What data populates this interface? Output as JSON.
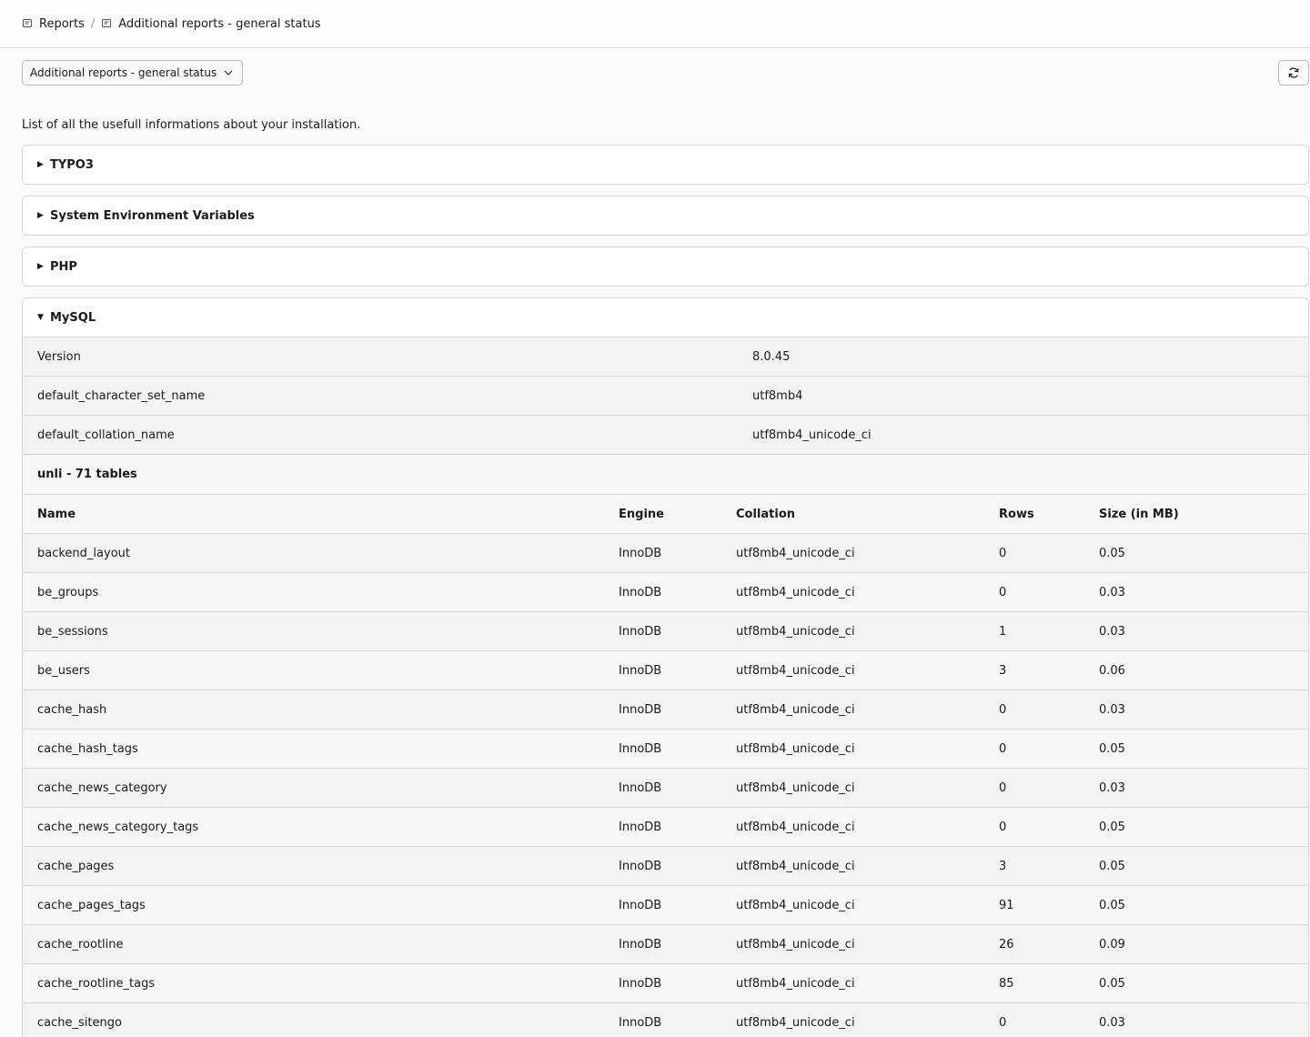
{
  "breadcrumb": {
    "root": "Reports",
    "current": "Additional reports - general status"
  },
  "toolbar": {
    "dropdown_value": "Additional reports - general status"
  },
  "intro": "List of all the usefull informations about your installation.",
  "sections": [
    {
      "title": "TYPO3",
      "expanded": false
    },
    {
      "title": "System Environment Variables",
      "expanded": false
    },
    {
      "title": "PHP",
      "expanded": false
    },
    {
      "title": "MySQL",
      "expanded": true
    }
  ],
  "mysql": {
    "properties": [
      {
        "key": "Version",
        "value": "8.0.45"
      },
      {
        "key": "default_character_set_name",
        "value": "utf8mb4"
      },
      {
        "key": "default_collation_name",
        "value": "utf8mb4_unicode_ci"
      }
    ],
    "database_title": "unli - 71 tables",
    "columns": [
      "Name",
      "Engine",
      "Collation",
      "Rows",
      "Size (in MB)"
    ],
    "tables": [
      [
        "backend_layout",
        "InnoDB",
        "utf8mb4_unicode_ci",
        "0",
        "0.05"
      ],
      [
        "be_groups",
        "InnoDB",
        "utf8mb4_unicode_ci",
        "0",
        "0.03"
      ],
      [
        "be_sessions",
        "InnoDB",
        "utf8mb4_unicode_ci",
        "1",
        "0.03"
      ],
      [
        "be_users",
        "InnoDB",
        "utf8mb4_unicode_ci",
        "3",
        "0.06"
      ],
      [
        "cache_hash",
        "InnoDB",
        "utf8mb4_unicode_ci",
        "0",
        "0.03"
      ],
      [
        "cache_hash_tags",
        "InnoDB",
        "utf8mb4_unicode_ci",
        "0",
        "0.05"
      ],
      [
        "cache_news_category",
        "InnoDB",
        "utf8mb4_unicode_ci",
        "0",
        "0.03"
      ],
      [
        "cache_news_category_tags",
        "InnoDB",
        "utf8mb4_unicode_ci",
        "0",
        "0.05"
      ],
      [
        "cache_pages",
        "InnoDB",
        "utf8mb4_unicode_ci",
        "3",
        "0.05"
      ],
      [
        "cache_pages_tags",
        "InnoDB",
        "utf8mb4_unicode_ci",
        "91",
        "0.05"
      ],
      [
        "cache_rootline",
        "InnoDB",
        "utf8mb4_unicode_ci",
        "26",
        "0.09"
      ],
      [
        "cache_rootline_tags",
        "InnoDB",
        "utf8mb4_unicode_ci",
        "85",
        "0.05"
      ],
      [
        "cache_sitengo",
        "InnoDB",
        "utf8mb4_unicode_ci",
        "0",
        "0.03"
      ]
    ]
  }
}
